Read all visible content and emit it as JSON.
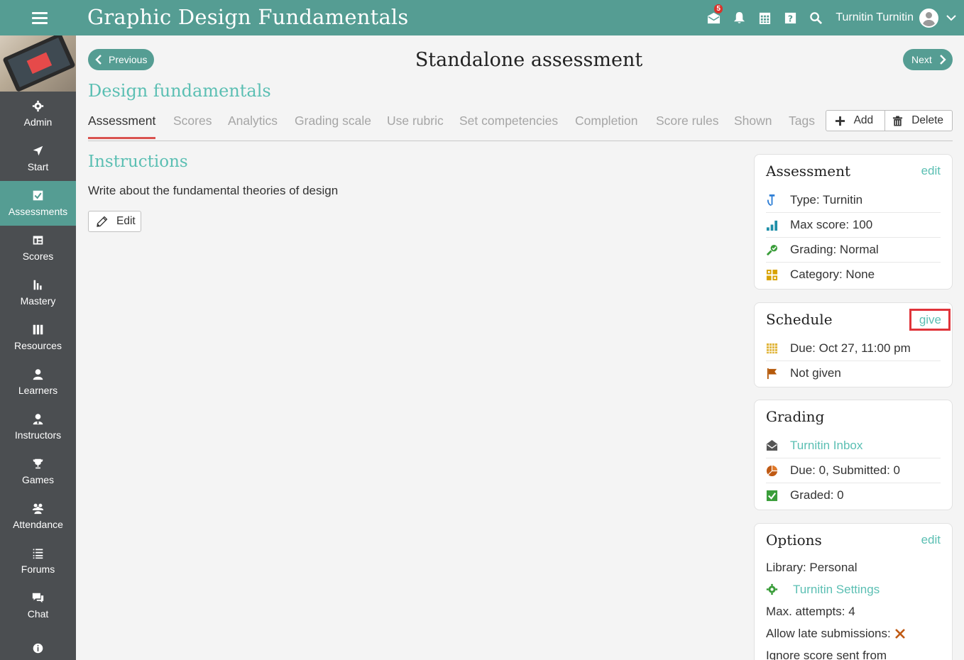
{
  "header": {
    "app_title": "Graphic Design Fundamentals",
    "notification_count": "5",
    "user_name": "Turnitin Turnitin"
  },
  "sidebar": {
    "items": [
      {
        "label": "Admin",
        "icon": "gear-icon"
      },
      {
        "label": "Start",
        "icon": "location-arrow-icon"
      },
      {
        "label": "Assessments",
        "icon": "checkbox-icon"
      },
      {
        "label": "Scores",
        "icon": "scores-table-icon"
      },
      {
        "label": "Mastery",
        "icon": "bar-chart-icon"
      },
      {
        "label": "Resources",
        "icon": "books-icon"
      },
      {
        "label": "Learners",
        "icon": "user-icon"
      },
      {
        "label": "Instructors",
        "icon": "instructor-icon"
      },
      {
        "label": "Games",
        "icon": "trophy-icon"
      },
      {
        "label": "Attendance",
        "icon": "group-icon"
      },
      {
        "label": "Forums",
        "icon": "list-icon"
      },
      {
        "label": "Chat",
        "icon": "chat-bubbles-icon"
      },
      {
        "label": "",
        "icon": "info-icon"
      }
    ],
    "active": "Assessments"
  },
  "nav": {
    "previous_label": "Previous",
    "next_label": "Next",
    "page_title": "Standalone assessment"
  },
  "course_name": "Design fundamentals",
  "tabs": [
    "Assessment",
    "Scores",
    "Analytics",
    "Grading scale",
    "Use rubric",
    "Set competencies",
    "Completion",
    "Score rules",
    "Shown",
    "Tags"
  ],
  "actions": {
    "add_label": "Add",
    "delete_label": "Delete"
  },
  "instructions": {
    "title": "Instructions",
    "text": "Write about the fundamental theories of design",
    "edit_label": "Edit"
  },
  "assessment_card": {
    "title": "Assessment",
    "edit_label": "edit",
    "rows": [
      {
        "text": "Type: Turnitin",
        "icon": "turnitin-icon"
      },
      {
        "text": "Max score: 100",
        "icon": "signal-bars-icon"
      },
      {
        "text": "Grading: Normal",
        "icon": "grading-check-icon"
      },
      {
        "text": "Category: None",
        "icon": "category-grid-icon"
      }
    ]
  },
  "schedule_card": {
    "title": "Schedule",
    "give_label": "give",
    "rows": [
      {
        "text": "Due: Oct 27, 11:00 pm",
        "icon": "calendar-icon"
      },
      {
        "text": "Not given",
        "icon": "flag-icon"
      }
    ]
  },
  "grading_card": {
    "title": "Grading",
    "rows": [
      {
        "text": "Turnitin Inbox",
        "icon": "inbox-envelope-icon"
      },
      {
        "text": "Due: 0, Submitted: 0",
        "icon": "pie-chart-icon"
      },
      {
        "text": "Graded: 0",
        "icon": "checked-box-icon"
      }
    ]
  },
  "options_card": {
    "title": "Options",
    "edit_label": "edit",
    "library": "Library: Personal",
    "turnitin_settings": "Turnitin Settings",
    "max_attempts": "Max. attempts: 4",
    "allow_late": "Allow late submissions:",
    "ignore_score": "Ignore score sent from"
  },
  "colors": {
    "brand": "#559d93",
    "accent_text": "#5bbfb3",
    "sidebar_bg": "#4b4e51",
    "tab_underline": "#d9534f",
    "highlight_box": "#e0343a"
  }
}
